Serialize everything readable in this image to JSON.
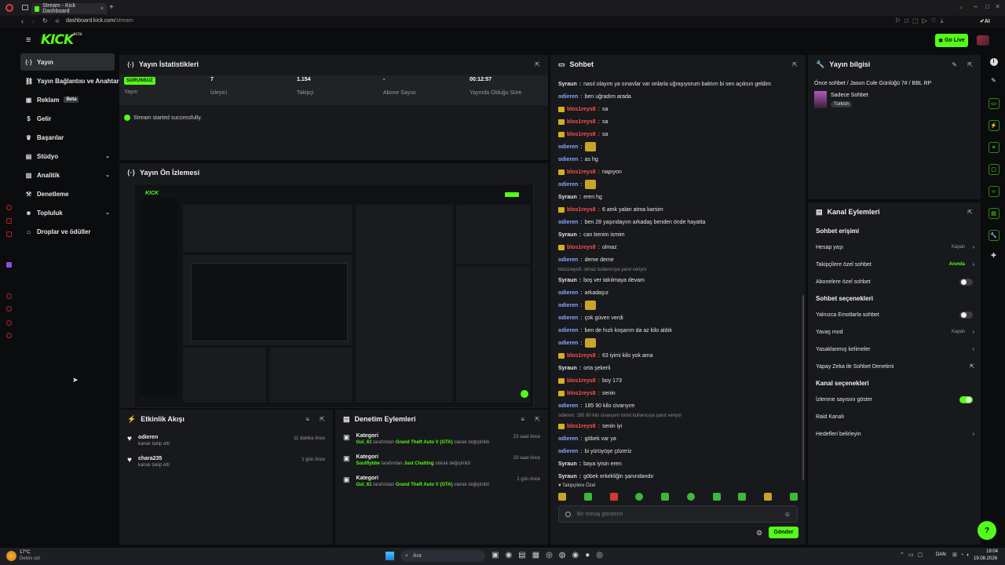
{
  "browser": {
    "tab_title": "Stream - Kick Dashboard",
    "url": "dashboard.kick.com/stream",
    "url_host": "dashboard.kick.com",
    "url_path": "/stream",
    "ai_label": "AI"
  },
  "header": {
    "logo": "KICK",
    "logo_sup": "BETA",
    "go_live": "Go Live"
  },
  "nav": {
    "items": [
      {
        "label": "Yayın",
        "icon": "broadcast-icon",
        "active": true
      },
      {
        "label": "Yayın Bağlantısı ve Anahtarı",
        "icon": "link-icon"
      },
      {
        "label": "Reklam",
        "icon": "ad-icon",
        "badge": "Beta"
      },
      {
        "label": "Gelir",
        "icon": "revenue-icon"
      },
      {
        "label": "Başarılar",
        "icon": "trophy-icon"
      },
      {
        "label": "Stüdyo",
        "icon": "studio-icon",
        "expand": true
      },
      {
        "label": "Analitik",
        "icon": "analytics-icon",
        "expand": true
      },
      {
        "label": "Denetleme",
        "icon": "moderation-icon"
      },
      {
        "label": "Topluluk",
        "icon": "community-icon",
        "expand": true
      },
      {
        "label": "Droplar ve ödüller",
        "icon": "gift-icon"
      }
    ]
  },
  "stats": {
    "title": "Yayın İstatistikleri",
    "status_badge": "SORUNSUZ",
    "status_label": "Yayın",
    "viewers": "7",
    "viewers_label": "İzleyici",
    "followers": "1.154",
    "followers_label": "Takipçi",
    "subs": "-",
    "subs_label": "Abone Sayısı",
    "uptime": "00:12:57",
    "uptime_label": "Yayında Olduğu Süre",
    "message": "Stream started successfully."
  },
  "preview": {
    "title": "Yayın Ön İzlemesi"
  },
  "activity": {
    "title": "Etkinlik Akışı",
    "items": [
      {
        "user": "odieren",
        "text": "kanalı takip etti",
        "time": "11 dakika önce"
      },
      {
        "user": "chara235",
        "text": "kanalı takip etti",
        "time": "1 gün önce"
      }
    ]
  },
  "modlog": {
    "title": "Denetim Eylemleri",
    "items": [
      {
        "title": "Kategori",
        "user": "Gul_61",
        "mid": "tarafından",
        "target": "Grand Theft Auto V (GTA)",
        "end": "olarak değiştirildi",
        "time": "23 saat önce"
      },
      {
        "title": "Kategori",
        "user": "Soulflybtw",
        "mid": "tarafından",
        "target": "Just Chatting",
        "end": "olarak değiştirildi",
        "time": "23 saat önce"
      },
      {
        "title": "Kategori",
        "user": "Gul_61",
        "mid": "tarafından",
        "target": "Grand Theft Auto V (GTA)",
        "end": "olarak değiştirildi",
        "time": "1 gün önce"
      }
    ]
  },
  "chat": {
    "title": "Sohbet",
    "messages": [
      {
        "user": "Syraun",
        "color": "white",
        "text": "nasıl olayım ya sınavlar var onlarla uğraşıyorum baktım bi sen açıksın geldim"
      },
      {
        "user": "odieren",
        "color": "blue",
        "text": "ben uğradım arada"
      },
      {
        "user": "blos1reys8",
        "color": "red",
        "badge": true,
        "text": "sa"
      },
      {
        "user": "blos1reys8",
        "color": "red",
        "badge": true,
        "text": "sa"
      },
      {
        "user": "blos1reys8",
        "color": "red",
        "badge": true,
        "text": "sa"
      },
      {
        "user": "odieren",
        "color": "blue",
        "text": "",
        "emote": true
      },
      {
        "user": "odieren",
        "color": "blue",
        "text": "as hg"
      },
      {
        "user": "blos1reys8",
        "color": "red",
        "badge": true,
        "text": "napıyon"
      },
      {
        "user": "odieren",
        "color": "blue",
        "text": "",
        "emote": true
      },
      {
        "user": "Syraun",
        "color": "white",
        "text": "eren hg"
      },
      {
        "user": "blos1reys8",
        "color": "red",
        "badge": true,
        "text": "6 amk yalan atma karsim"
      },
      {
        "user": "odieren",
        "color": "blue",
        "text": "ben 28 yaşındayım arkadaş benden önde hayatta"
      },
      {
        "user": "Syraun",
        "color": "white",
        "text": "can benim ismim"
      },
      {
        "user": "blos1reys8",
        "color": "red",
        "badge": true,
        "text": "olmaz"
      },
      {
        "user": "odieren",
        "color": "blue",
        "text": "deme deme"
      },
      {
        "sys": "blos1reys8: olmaz kullanıcıya yanıt veriyor"
      },
      {
        "user": "Syraun",
        "color": "white",
        "text": "boş ver takılmaya devam"
      },
      {
        "user": "odieren",
        "color": "blue",
        "text": "arkadaşız"
      },
      {
        "user": "odieren",
        "color": "blue",
        "text": "",
        "emote": true
      },
      {
        "user": "odieren",
        "color": "blue",
        "text": "çok güven verdi"
      },
      {
        "user": "odieren",
        "color": "blue",
        "text": "ben de hızlı koşarım da az kilo aldık"
      },
      {
        "user": "odieren",
        "color": "blue",
        "text": "",
        "emote": true
      },
      {
        "user": "blos1reys8",
        "color": "red",
        "badge": true,
        "text": "63 iyimi kilo yok ama"
      },
      {
        "user": "Syraun",
        "color": "white",
        "text": "orta şekerli"
      },
      {
        "user": "blos1reys8",
        "color": "red",
        "badge": true,
        "text": "boy 173"
      },
      {
        "user": "blos1reys8",
        "color": "red",
        "badge": true,
        "text": "senin"
      },
      {
        "user": "odieren",
        "color": "blue",
        "text": "185 90 kilo civarıyım"
      },
      {
        "sys": "odieren: 185 90 kilo civarıyım isimli kullanıcıya yanıt veriyor"
      },
      {
        "user": "blos1reys8",
        "color": "red",
        "badge": true,
        "text": "senin iyi"
      },
      {
        "user": "odieren",
        "color": "blue",
        "text": "göbek var ya"
      },
      {
        "user": "odieren",
        "color": "blue",
        "text": "bi yürüyüşe çözeriz"
      },
      {
        "user": "Syraun",
        "color": "white",
        "text": "baya iyisin eren"
      },
      {
        "user": "Syraun",
        "color": "white",
        "text": "göbek erkekliğin şanındandır"
      }
    ],
    "followers_only": "Takipçilere Özel",
    "placeholder": "Bir mesaj gönderin",
    "send": "Gönder"
  },
  "info": {
    "title": "Yayın bilgisi",
    "stream_title": "Önce sohbet / Jason Cole Günlüğü 7# / BBL RP",
    "category": "Sadece Sohbet",
    "language": "Turkish"
  },
  "channel": {
    "title": "Kanal Eylemleri",
    "chat_access": "Sohbet erişimi",
    "account_age": "Hesap yaşı",
    "account_age_val": "Kapalı",
    "followers_only": "Takipçilere özel sohbet",
    "followers_only_val": "Anında",
    "subs_only": "Abonelere özel sohbet",
    "chat_options": "Sohbet seçenekleri",
    "emotes_only": "Yalnızca Emotlarla sohbet",
    "slow_mode": "Yavaş mod",
    "slow_mode_val": "Kapalı",
    "banned_words": "Yasaklanmış kelimeler",
    "ai_mod": "Yapay Zeka ile Sohbet Denetimi",
    "channel_options": "Kanal seçenekleri",
    "show_viewers": "İzlenme sayısını göster",
    "raid": "Raid Kanalı",
    "goals": "Hedefleri belirleyin"
  },
  "taskbar": {
    "temp": "17°C",
    "weather": "Delvis sol",
    "search": "Ara",
    "lang": "DAN",
    "time": "19:04",
    "date": "19.08.2026"
  },
  "colors": {
    "accent": "#53fc18",
    "panel": "#18191c",
    "bg": "#0b0c0e"
  }
}
